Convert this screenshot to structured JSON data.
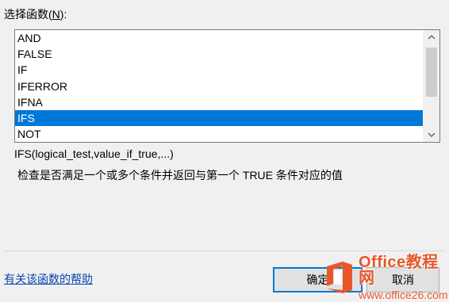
{
  "dialog": {
    "select_function_label": "选择函数(",
    "select_function_hotkey": "N",
    "select_function_suffix": "):",
    "functions": [
      "AND",
      "FALSE",
      "IF",
      "IFERROR",
      "IFNA",
      "IFS",
      "NOT"
    ],
    "selected_function": "IFS",
    "signature": "IFS(logical_test,value_if_true,...)",
    "description": "检查是否满足一个或多个条件并返回与第一个 TRUE 条件对应的值",
    "help_link": "有关该函数的帮助",
    "ok_button": "确定",
    "cancel_button": "取消"
  },
  "watermark": {
    "title": "Office教程网",
    "subtitle": "www.office26.com",
    "logo_icon": "office-logo-icon",
    "color": "#e8562a"
  },
  "colors": {
    "selection": "#0078d7",
    "link": "#0645ad"
  }
}
